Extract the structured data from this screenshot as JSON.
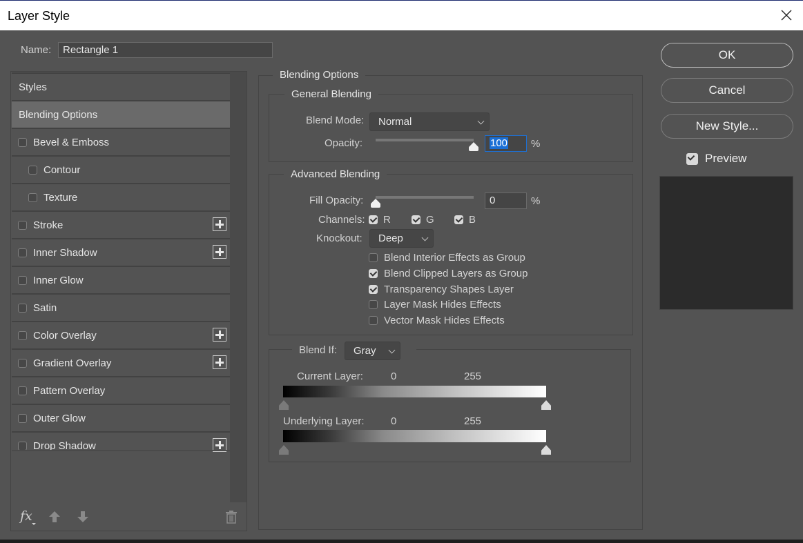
{
  "window": {
    "title": "Layer Style",
    "close_icon": "close-x-icon"
  },
  "name_field": {
    "label": "Name:",
    "value": "Rectangle 1"
  },
  "styles_list": {
    "header": "Styles",
    "items": [
      {
        "label": "Blending Options",
        "selected": true,
        "has_checkbox": false,
        "checked": false,
        "has_plus": false,
        "indent": false
      },
      {
        "label": "Bevel & Emboss",
        "selected": false,
        "has_checkbox": true,
        "checked": false,
        "has_plus": false,
        "indent": false
      },
      {
        "label": "Contour",
        "selected": false,
        "has_checkbox": true,
        "checked": false,
        "has_plus": false,
        "indent": true
      },
      {
        "label": "Texture",
        "selected": false,
        "has_checkbox": true,
        "checked": false,
        "has_plus": false,
        "indent": true
      },
      {
        "label": "Stroke",
        "selected": false,
        "has_checkbox": true,
        "checked": false,
        "has_plus": true,
        "indent": false
      },
      {
        "label": "Inner Shadow",
        "selected": false,
        "has_checkbox": true,
        "checked": false,
        "has_plus": true,
        "indent": false
      },
      {
        "label": "Inner Glow",
        "selected": false,
        "has_checkbox": true,
        "checked": false,
        "has_plus": false,
        "indent": false
      },
      {
        "label": "Satin",
        "selected": false,
        "has_checkbox": true,
        "checked": false,
        "has_plus": false,
        "indent": false
      },
      {
        "label": "Color Overlay",
        "selected": false,
        "has_checkbox": true,
        "checked": false,
        "has_plus": true,
        "indent": false
      },
      {
        "label": "Gradient Overlay",
        "selected": false,
        "has_checkbox": true,
        "checked": false,
        "has_plus": true,
        "indent": false
      },
      {
        "label": "Pattern Overlay",
        "selected": false,
        "has_checkbox": true,
        "checked": false,
        "has_plus": false,
        "indent": false
      },
      {
        "label": "Outer Glow",
        "selected": false,
        "has_checkbox": true,
        "checked": false,
        "has_plus": false,
        "indent": false
      },
      {
        "label": "Drop Shadow",
        "selected": false,
        "has_checkbox": true,
        "checked": false,
        "has_plus": true,
        "indent": false
      }
    ],
    "footer": {
      "fx_label": "fx",
      "icons": [
        "fx-menu-icon",
        "move-up-arrow-icon",
        "move-down-arrow-icon",
        "trash-icon"
      ]
    }
  },
  "blending_options": {
    "title": "Blending Options",
    "general": {
      "title": "General Blending",
      "blend_mode_label": "Blend Mode:",
      "blend_mode_value": "Normal",
      "opacity_label": "Opacity:",
      "opacity_value": "100",
      "opacity_fraction": 1.0,
      "percent": "%"
    },
    "advanced": {
      "title": "Advanced Blending",
      "fill_opacity_label": "Fill Opacity:",
      "fill_opacity_value": "0",
      "fill_opacity_fraction": 0.0,
      "percent": "%",
      "channels_label": "Channels:",
      "channels": [
        {
          "label": "R",
          "checked": true
        },
        {
          "label": "G",
          "checked": true
        },
        {
          "label": "B",
          "checked": true
        }
      ],
      "knockout_label": "Knockout:",
      "knockout_value": "Deep",
      "options": [
        {
          "label": "Blend Interior Effects as Group",
          "checked": false
        },
        {
          "label": "Blend Clipped Layers as Group",
          "checked": true
        },
        {
          "label": "Transparency Shapes Layer",
          "checked": true
        },
        {
          "label": "Layer Mask Hides Effects",
          "checked": false
        },
        {
          "label": "Vector Mask Hides Effects",
          "checked": false
        }
      ]
    },
    "blend_if": {
      "label": "Blend If:",
      "value": "Gray",
      "current_layer": {
        "label": "Current Layer:",
        "low": "0",
        "high": "255"
      },
      "underlying_layer": {
        "label": "Underlying Layer:",
        "low": "0",
        "high": "255"
      }
    }
  },
  "actions": {
    "ok": "OK",
    "cancel": "Cancel",
    "new_style": "New Style...",
    "preview_label": "Preview",
    "preview_checked": true
  }
}
